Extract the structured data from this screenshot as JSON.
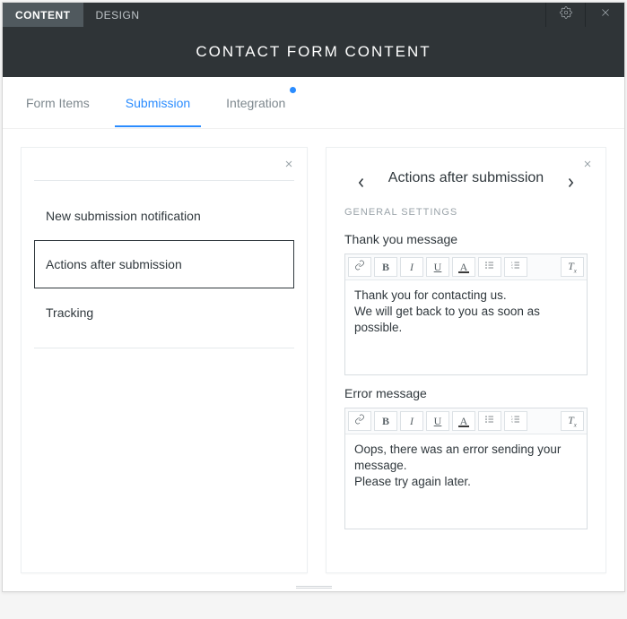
{
  "top_tabs": {
    "content": "CONTENT",
    "design": "DESIGN"
  },
  "dialog_title": "CONTACT FORM CONTENT",
  "subtabs": {
    "form_items": "Form Items",
    "submission": "Submission",
    "integration": "Integration"
  },
  "left_panel": {
    "items": [
      {
        "label": "New submission notification"
      },
      {
        "label": "Actions after submission"
      },
      {
        "label": "Tracking"
      }
    ]
  },
  "right_panel": {
    "title": "Actions after submission",
    "section_label": "GENERAL SETTINGS",
    "fields": {
      "thank_you": {
        "label": "Thank you message",
        "value": "Thank you for contacting us.\nWe will get back to you as soon as possible."
      },
      "error": {
        "label": "Error message",
        "value": "Oops, there was an error sending your message.\nPlease try again later."
      }
    }
  },
  "toolbar_buttons": {
    "link": "link-icon",
    "bold": "B",
    "italic": "I",
    "underline": "U",
    "textcolor": "A",
    "ul": "bullet-list-icon",
    "ol": "numbered-list-icon",
    "clear": "clear-format-icon"
  }
}
